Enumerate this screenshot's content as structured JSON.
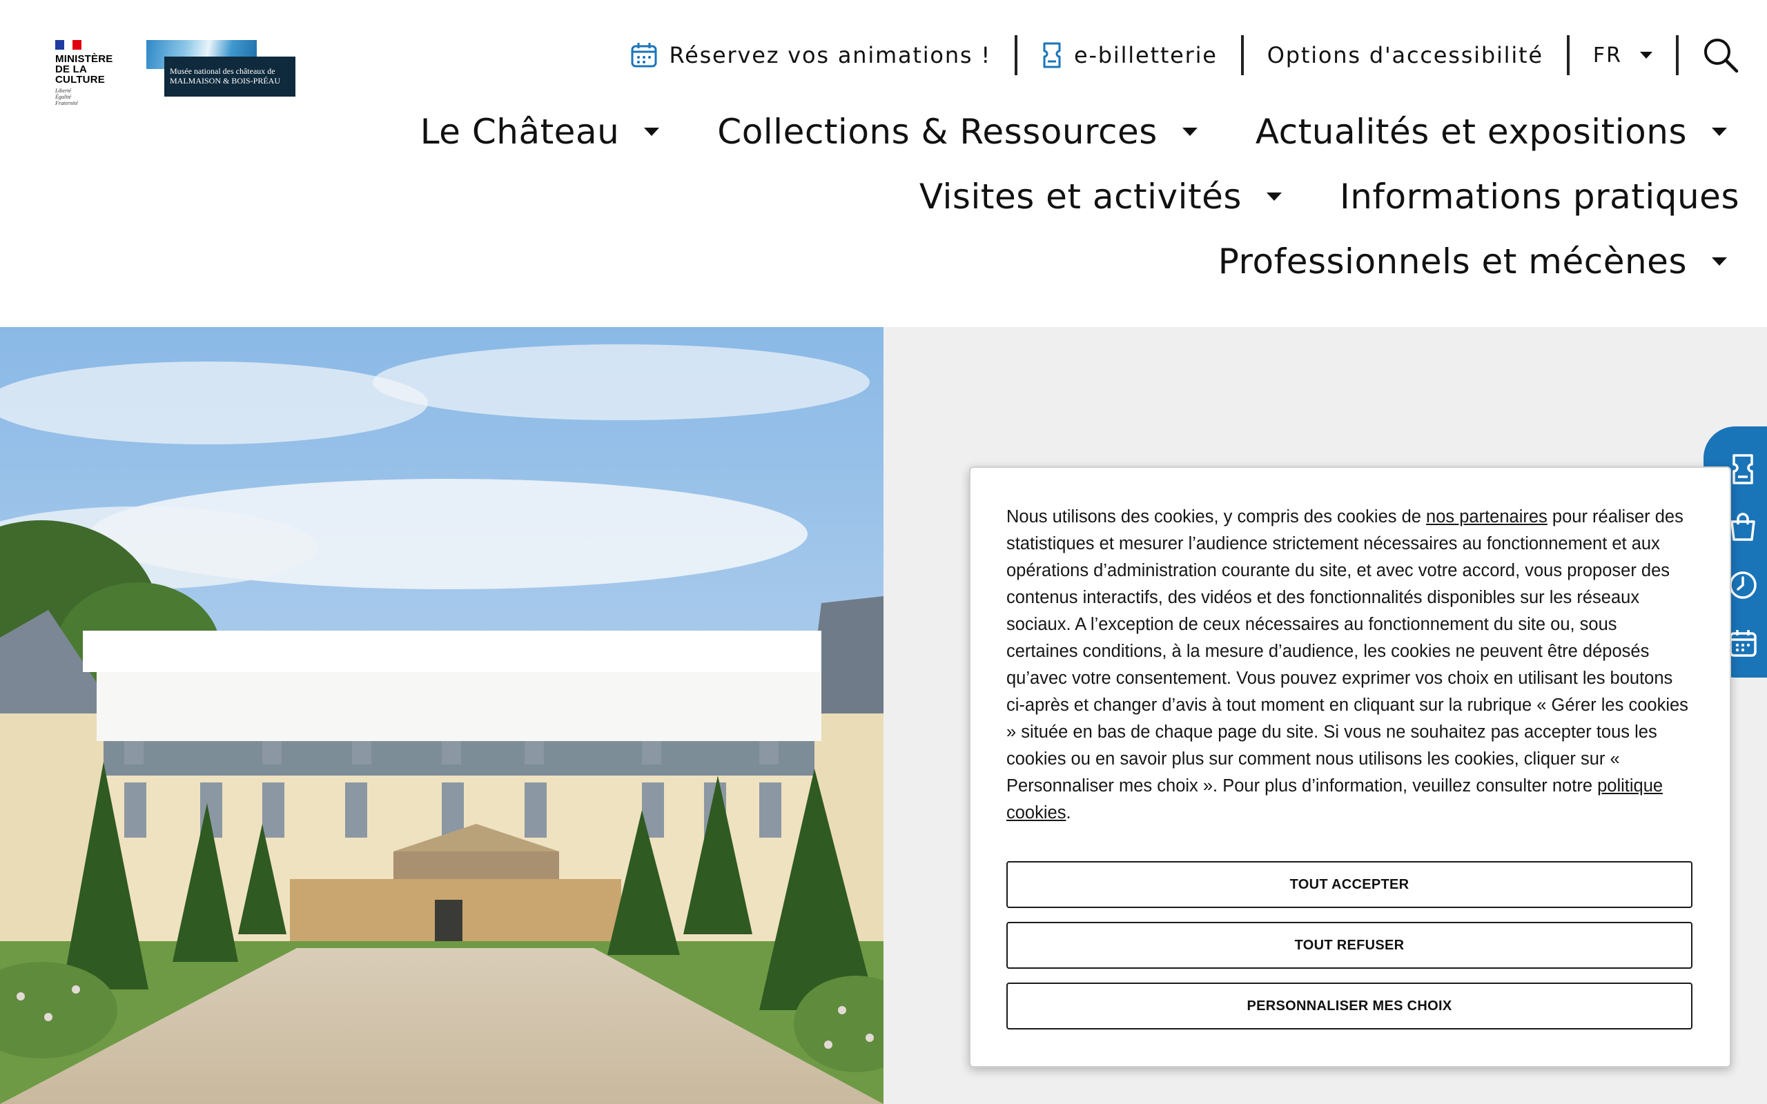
{
  "header": {
    "ministere": {
      "line1": "MINISTÈRE",
      "line2": "DE LA CULTURE",
      "motto": [
        "Liberté",
        "Égalité",
        "Fraternité"
      ]
    },
    "musee": {
      "line1": "Musée national des châteaux de",
      "line2": "MALMAISON & BOIS-PRÉAU"
    },
    "utility": {
      "reserve_label": "Réservez vos animations !",
      "ticketing_label": "e-billetterie",
      "accessibility_label": "Options d'accessibilité",
      "language": "FR"
    },
    "nav": {
      "items": [
        "Le Château",
        "Collections & Ressources",
        "Actualités et expositions",
        "Visites et activités",
        "Informations pratiques",
        "Professionnels et mécènes"
      ]
    }
  },
  "cookie": {
    "text_before_link": "Nous utilisons des cookies, y compris des cookies de ",
    "partners_link": "nos partenaires",
    "text_middle": " pour réaliser des statistiques et mesurer l’audience strictement nécessaires au fonctionnement et aux opérations d’administration courante du site, et avec votre accord, vous proposer des contenus interactifs, des vidéos et des fonctionnalités disponibles sur les réseaux sociaux. A l’exception de ceux nécessaires au fonctionnement du site ou, sous certaines conditions, à la mesure d’audience, les cookies ne peuvent être déposés qu’avec votre consentement. Vous pouvez exprimer vos choix en utilisant les boutons ci-après et changer d’avis à tout moment en cliquant sur la rubrique « Gérer les cookies » située en bas de chaque page du site. Si vous ne souhaitez pas accepter tous les cookies ou en savoir plus sur comment nous utilisons les cookies, cliquer sur « Personnaliser mes choix ». Pour plus d’information, veuillez consulter notre ",
    "policy_link": "politique cookies",
    "text_end": ".",
    "accept_label": "TOUT ACCEPTER",
    "refuse_label": "TOUT REFUSER",
    "customize_label": "PERSONNALISER MES CHOIX"
  },
  "icons": {
    "reserve": "calendar-icon",
    "ticketing": "ticket-icon",
    "language": "chevron-down-icon",
    "search": "search-icon",
    "side": [
      "ticket-icon",
      "shopping-bag-icon",
      "clock-icon",
      "calendar-icon"
    ]
  },
  "colors": {
    "accent_blue": "#1a74b8",
    "panel_grey": "#efefef",
    "text": "#111111"
  }
}
